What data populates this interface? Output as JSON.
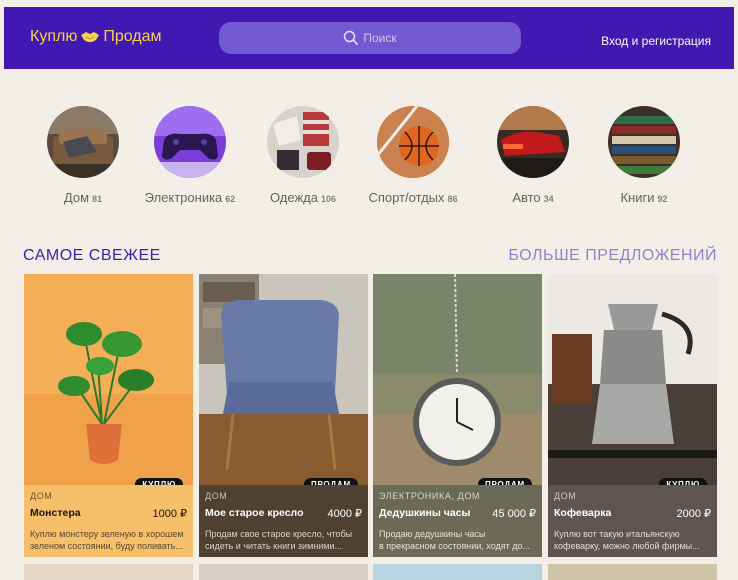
{
  "header": {
    "logo_left": "Куплю",
    "logo_right": "Продам",
    "search_placeholder": "Поиск",
    "login_label": "Вход и регистрация"
  },
  "categories": [
    {
      "label": "Дом",
      "count": "81"
    },
    {
      "label": "Электроника",
      "count": "62"
    },
    {
      "label": "Одежда",
      "count": "106"
    },
    {
      "label": "Спорт/отдых",
      "count": "86"
    },
    {
      "label": "Авто",
      "count": "34"
    },
    {
      "label": "Книги",
      "count": "92"
    }
  ],
  "section": {
    "title": "САМОЕ СВЕЖЕЕ",
    "more": "БОЛЬШЕ ПРЕДЛОЖЕНИЙ"
  },
  "cards": [
    {
      "badge": "КУПЛЮ",
      "category": "ДОМ",
      "title": "Монстера",
      "price": "1000 ₽",
      "desc_line1": "Куплю монстеру зеленую в хорошем",
      "desc_line2": "зеленом состоянии, буду поливать..."
    },
    {
      "badge": "ПРОДАМ",
      "category": "ДОМ",
      "title": "Мое старое кресло",
      "price": "4000 ₽",
      "desc_line1": "Продам свое старое кресло, чтобы",
      "desc_line2": "сидеть и читать книги зимними..."
    },
    {
      "badge": "ПРОДАМ",
      "category": "ЭЛЕКТРОНИКА, ДОМ",
      "title": "Дедушкины часы",
      "price": "45 000 ₽",
      "desc_line1": "Продаю дедушкины часы",
      "desc_line2": "в прекрасном состоянии, ходят до..."
    },
    {
      "badge": "КУПЛЮ",
      "category": "ДОМ",
      "title": "Кофеварка",
      "price": "2000 ₽",
      "desc_line1": "Куплю вот такую итальянскую",
      "desc_line2": "кофеварку, можно любой фирмы..."
    }
  ],
  "colors": {
    "header_bg": "#4218b3",
    "logo": "#f5d24a",
    "section_title": "#3b1fa8",
    "more_link": "#8b86c9"
  }
}
